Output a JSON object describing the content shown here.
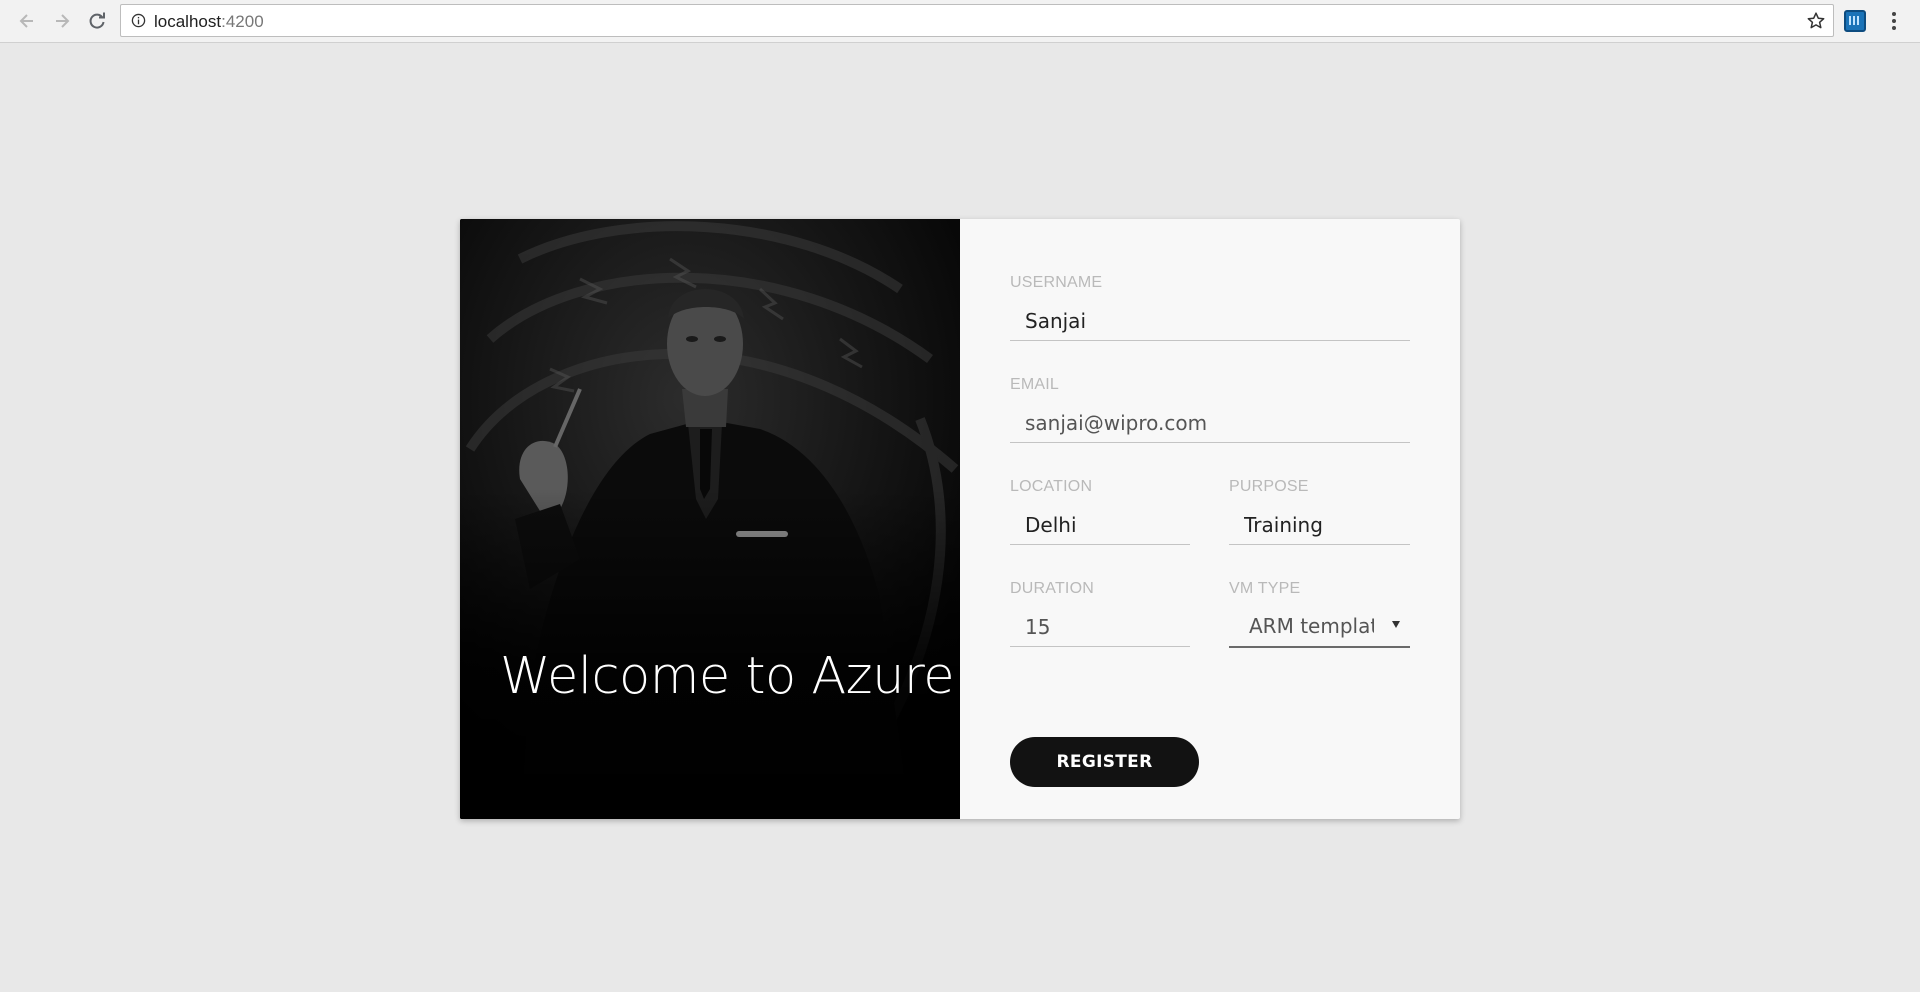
{
  "browser": {
    "url_host": "localhost",
    "url_port": ":4200",
    "back_icon": "arrow-left-icon",
    "forward_icon": "arrow-right-icon",
    "reload_icon": "reload-icon",
    "info_icon": "info-icon",
    "bookmark_icon": "star-icon",
    "extension_icon": "extension-icon",
    "menu_icon": "kebab-menu-icon"
  },
  "hero": {
    "title": "Welcome to Azure"
  },
  "form": {
    "username": {
      "label": "USERNAME",
      "value": "Sanjai"
    },
    "email": {
      "label": "EMAIL",
      "value": "sanjai@wipro.com"
    },
    "location": {
      "label": "LOCATION",
      "value": "Delhi"
    },
    "purpose": {
      "label": "PURPOSE",
      "value": "Training"
    },
    "duration": {
      "label": "DURATION",
      "value": "15"
    },
    "vm_type": {
      "label": "VM TYPE",
      "value": "ARM template"
    },
    "register_label": "REGISTER"
  },
  "colors": {
    "page_background": "#e8e8e8",
    "card_background": "#f8f8f8",
    "hero_background": "#050505",
    "button_background": "#121212"
  }
}
